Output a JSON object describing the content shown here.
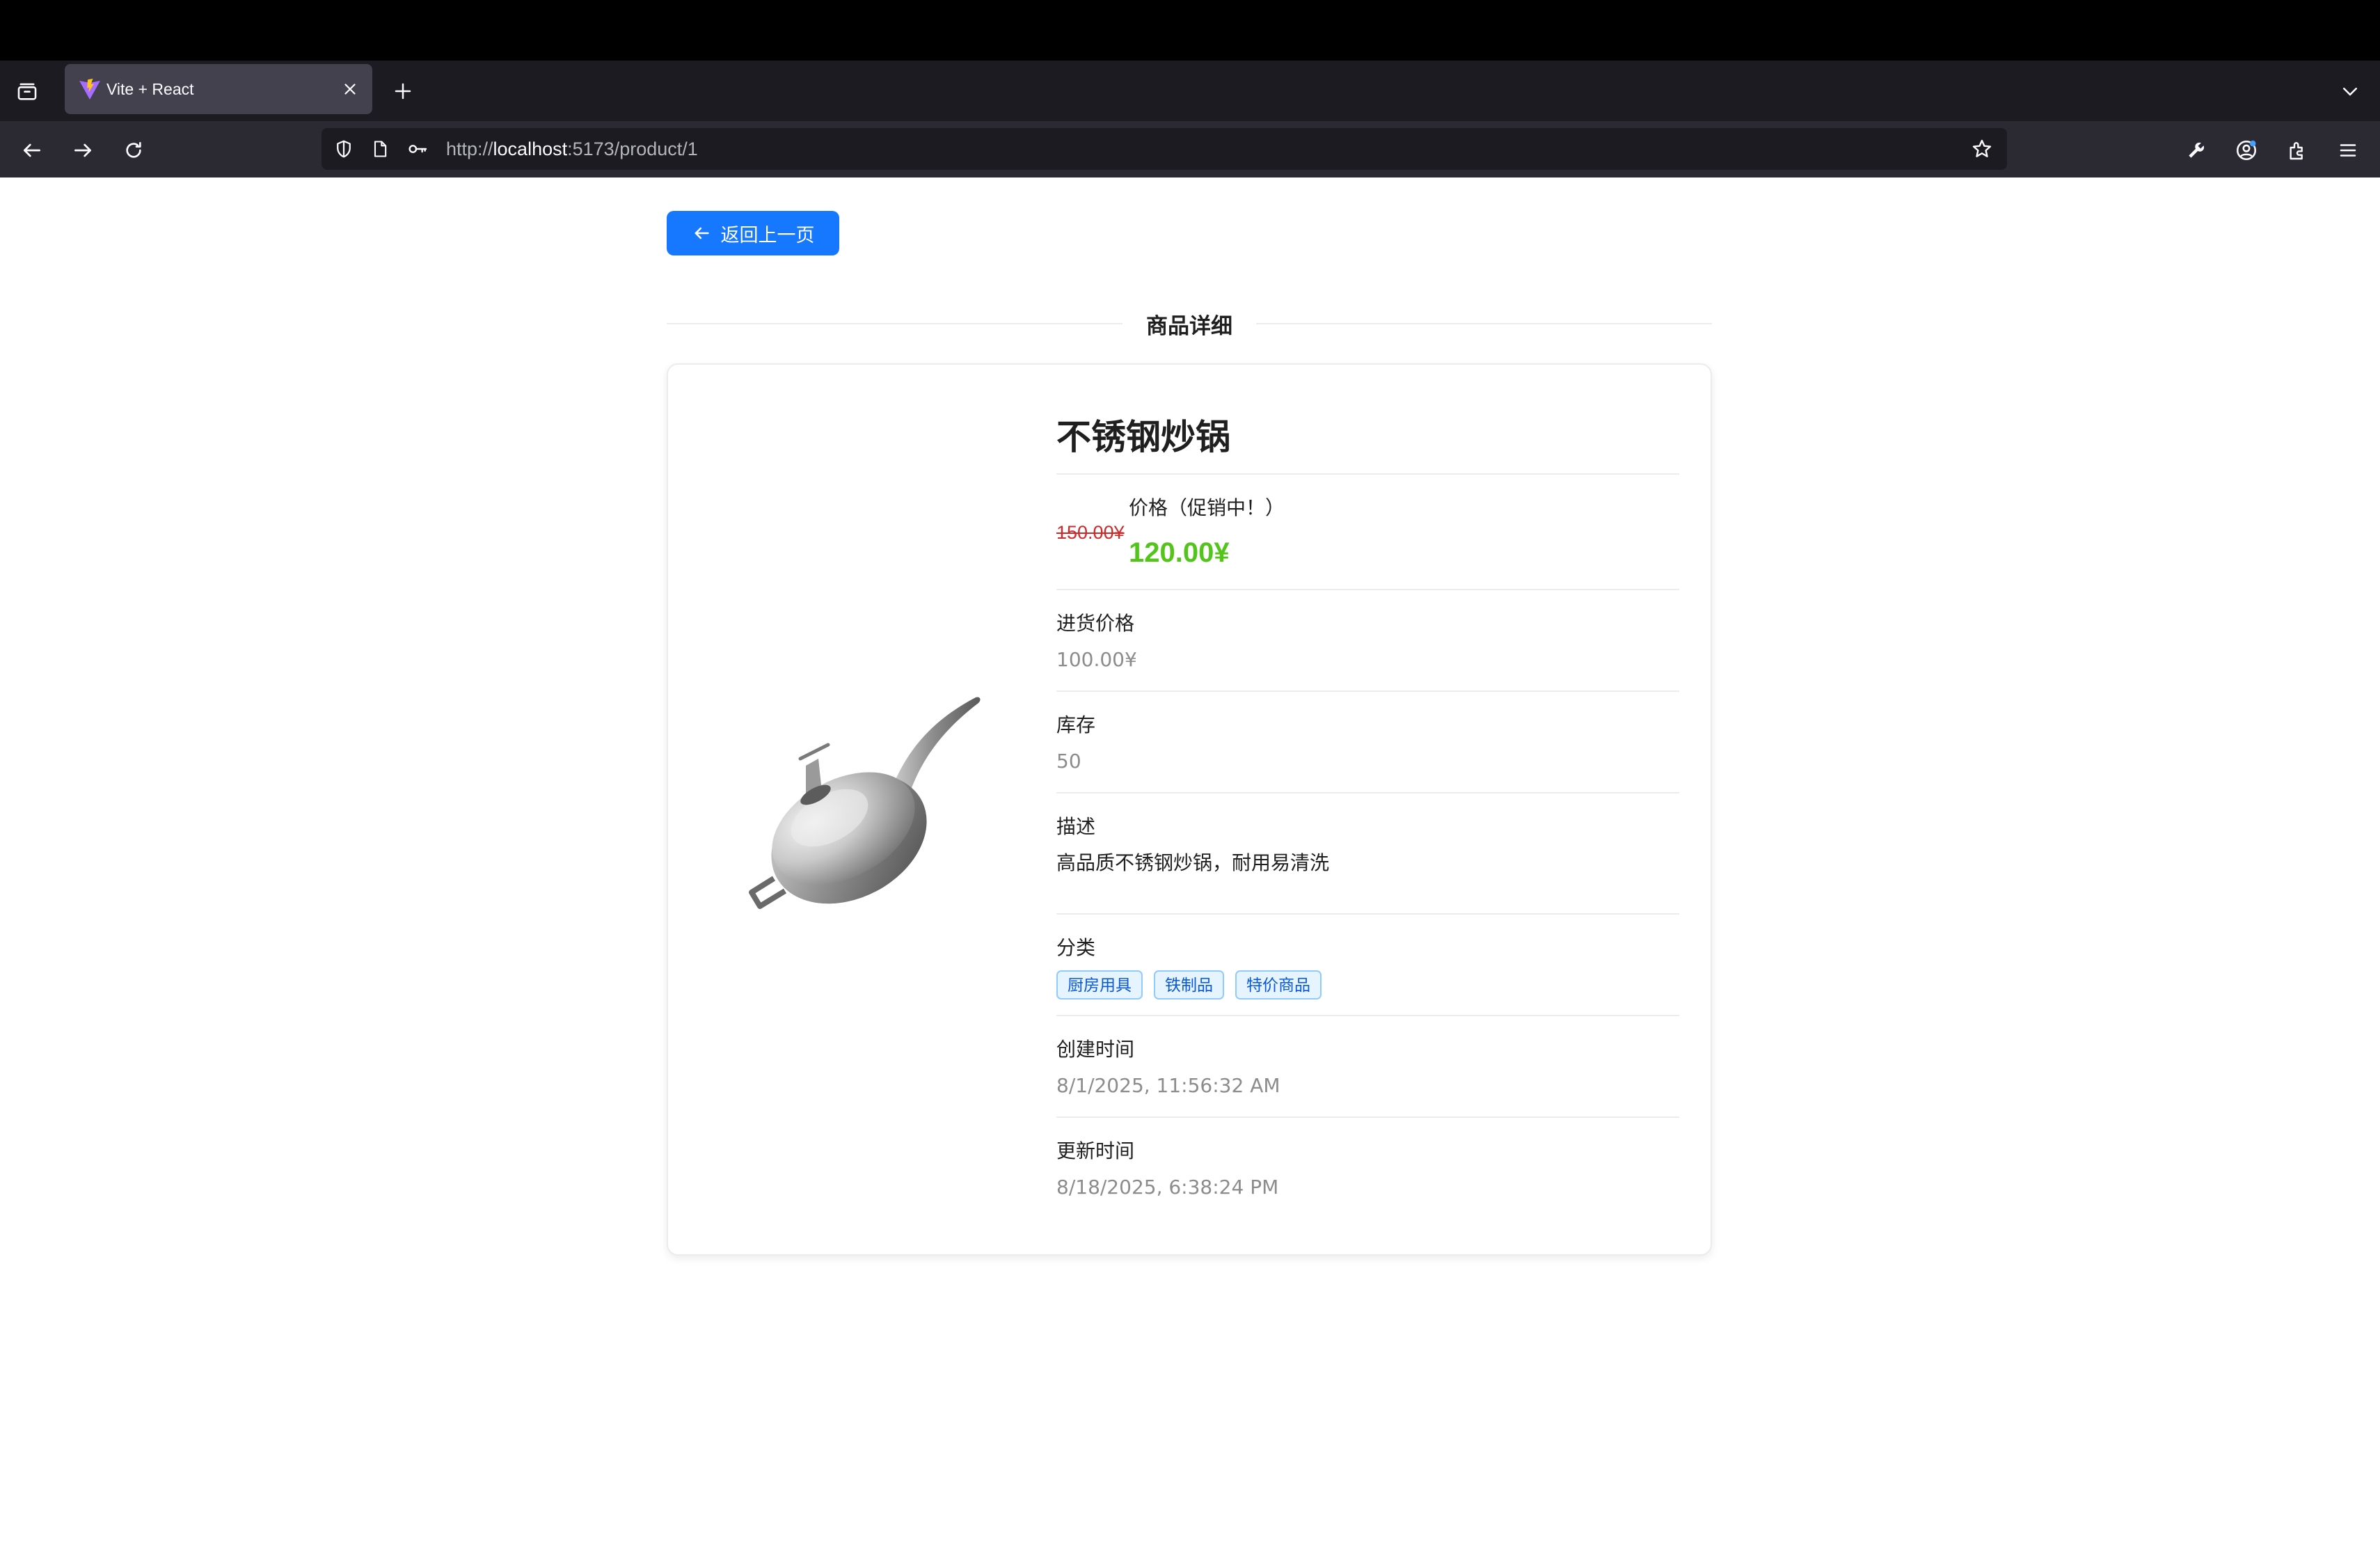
{
  "browser": {
    "tab": {
      "title": "Vite + React"
    },
    "url": {
      "prefix": "http://",
      "host": "localhost",
      "path": ":5173/product/1"
    }
  },
  "page": {
    "back_button_label": "返回上一页",
    "section_title": "商品详细",
    "product": {
      "name": "不锈钢炒锅",
      "price_label": "价格（促销中！）",
      "original_price": "150.00¥",
      "sale_price": "120.00¥",
      "purchase_price_label": "进货价格",
      "purchase_price": "100.00¥",
      "stock_label": "库存",
      "stock": "50",
      "description_label": "描述",
      "description": "高品质不锈钢炒锅，耐用易清洗",
      "category_label": "分类",
      "categories": [
        "厨房用具",
        "铁制品",
        "特价商品"
      ],
      "created_label": "创建时间",
      "created_at": "8/1/2025, 11:56:32 AM",
      "updated_label": "更新时间",
      "updated_at": "8/18/2025, 6:38:24 PM"
    }
  },
  "colors": {
    "primary": "#1677ff",
    "sale_price": "#52c41a",
    "original_price": "#cf2a2a",
    "tag_text": "#0958d9",
    "tag_bg": "#e6f4ff"
  }
}
